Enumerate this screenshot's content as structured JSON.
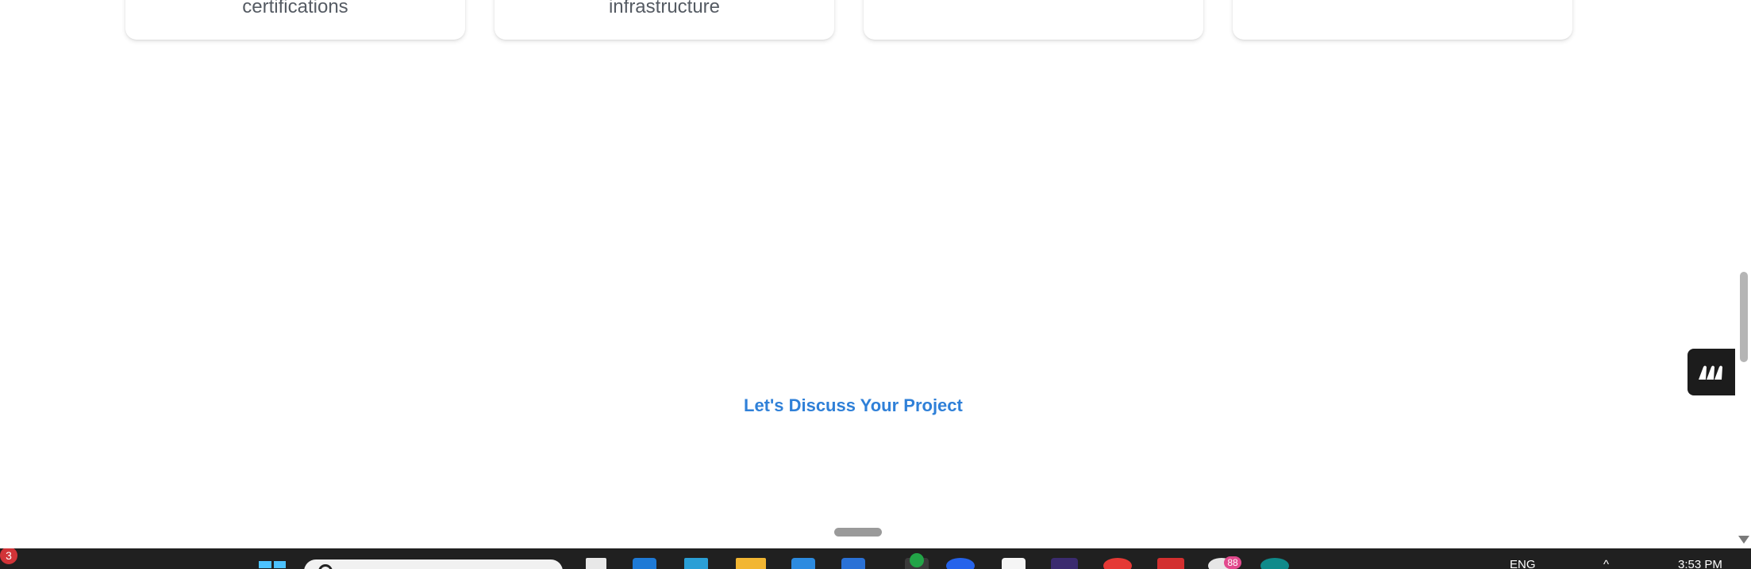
{
  "cards": [
    {
      "text": "certifications"
    },
    {
      "text": "infrastructure"
    },
    {
      "text": ""
    },
    {
      "text": ""
    }
  ],
  "cta": {
    "label": "Let's Discuss Your Project"
  },
  "taskbar": {
    "notification_count": "3",
    "app_badge_count": "88",
    "language": "ENG",
    "time": "3:53 PM"
  },
  "colors": {
    "accent": "#2f80d8",
    "widget_bg": "#1c1c1c",
    "taskbar_bg": "#202020"
  }
}
